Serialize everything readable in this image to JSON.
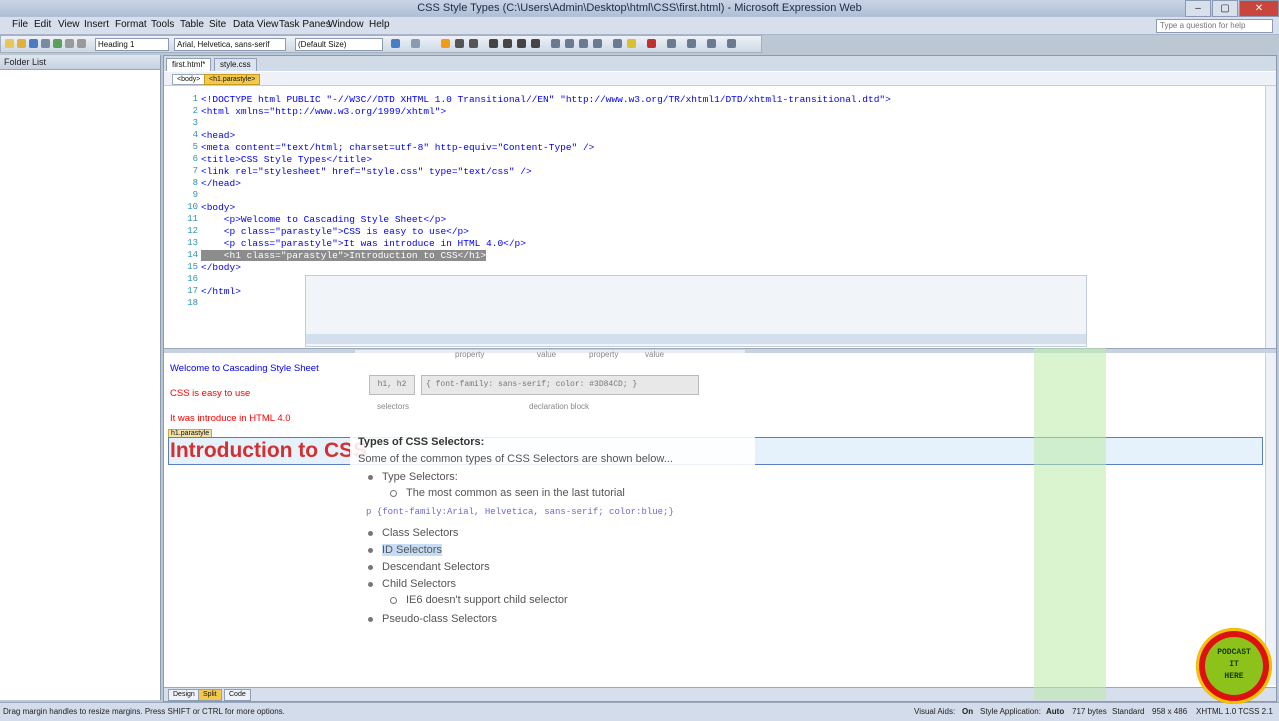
{
  "window": {
    "title": "CSS Style Types (C:\\Users\\Admin\\Desktop\\html\\CSS\\first.html) - Microsoft Expression Web",
    "min": "–",
    "max": "▢",
    "close": "✕"
  },
  "menu": [
    "File",
    "Edit",
    "View",
    "Insert",
    "Format",
    "Tools",
    "Table",
    "Site",
    "Data View",
    "Task Panes",
    "Window",
    "Help"
  ],
  "help_placeholder": "Type a question for help",
  "toolbar": {
    "style_select": "Heading 1",
    "font_select": "Arial, Helvetica, sans-serif",
    "size_select": "(Default Size)"
  },
  "folder_list": {
    "title": "Folder List"
  },
  "doc_tabs": [
    "first.html*",
    "style.css"
  ],
  "breadcrumbs": [
    "<body>",
    "<h1.parastyle>"
  ],
  "code_lines": [
    {
      "n": "1",
      "tag": "<!DOCTYPE html PUBLIC \"-//W3C//DTD XHTML 1.0 Transitional//EN\" \"http://www.w3.org/TR/xhtml1/DTD/xhtml1-transitional.dtd\">"
    },
    {
      "n": "2",
      "tag": "<html xmlns=\"http://www.w3.org/1999/xhtml\">"
    },
    {
      "n": "3",
      "tag": ""
    },
    {
      "n": "4",
      "tag": "<head>"
    },
    {
      "n": "5",
      "tag": "<meta content=\"text/html; charset=utf-8\" http-equiv=\"Content-Type\" />"
    },
    {
      "n": "6",
      "tag": "<title>CSS Style Types</title>"
    },
    {
      "n": "7",
      "tag": "<link rel=\"stylesheet\" href=\"style.css\" type=\"text/css\" />"
    },
    {
      "n": "8",
      "tag": "</head>"
    },
    {
      "n": "9",
      "tag": ""
    },
    {
      "n": "10",
      "tag": "<body>"
    },
    {
      "n": "11",
      "tag": "    <p>Welcome to Cascading Style Sheet</p>"
    },
    {
      "n": "12",
      "tag": "    <p class=\"parastyle\">CSS is easy to use</p>"
    },
    {
      "n": "13",
      "tag": "    <p class=\"parastyle\">It was introduce in HTML 4.0</p>"
    },
    {
      "n": "14",
      "tag": "    <h1 class=\"parastyle\">Introduction to CSS</h1>"
    },
    {
      "n": "15",
      "tag": "</body>"
    },
    {
      "n": "16",
      "tag": ""
    },
    {
      "n": "17",
      "tag": "</html>"
    },
    {
      "n": "18",
      "tag": ""
    }
  ],
  "design": {
    "p1": "Welcome to Cascading Style Sheet",
    "p2": "CSS is easy to use",
    "p3": "It was introduce in HTML 4.0",
    "h1_tag": "h1.parastyle",
    "h1": "Introduction to CSS"
  },
  "ghost_figure": {
    "labels": [
      "property",
      "value",
      "property",
      "value"
    ],
    "selector_box": "h1, h2",
    "declaration_box": "{ font-family: sans-serif; color: #3D84CD; }",
    "selectors_label": "selectors",
    "declaration_label": "declaration block"
  },
  "overlay": {
    "title": "Types of CSS Selectors:",
    "subtitle": "Some of the common types of CSS Selectors are shown below...",
    "items": [
      {
        "text": "Type Selectors:",
        "level": 1
      },
      {
        "text": "The most common as seen in the last tutorial",
        "level": 2
      },
      {
        "text": "Class Selectors",
        "level": 1
      },
      {
        "text": "ID Selectors",
        "level": 1
      },
      {
        "text": "Descendant Selectors",
        "level": 1
      },
      {
        "text": "Child Selectors",
        "level": 1
      },
      {
        "text": "IE6 doesn't support child selector",
        "level": 2
      },
      {
        "text": "Pseudo-class Selectors",
        "level": 1
      }
    ],
    "code": "p {font-family:Arial, Helvetica, sans-serif; color:blue;}"
  },
  "view_tabs": [
    "Design",
    "Split",
    "Code"
  ],
  "status": {
    "left": "Drag margin handles to resize margins. Press SHIFT or CTRL for more options.",
    "visual_aids": "Visual Aids:",
    "visual_aids_val": "On",
    "style_app": "Style Application:",
    "style_app_val": "Auto",
    "bytes": "717 bytes",
    "mode": "Standard",
    "dims": "958 x 486",
    "doctype": "XHTML 1.0 T",
    "css": "CSS 2.1"
  },
  "logo_text": [
    "PODCAST",
    "IT",
    "HERE"
  ]
}
